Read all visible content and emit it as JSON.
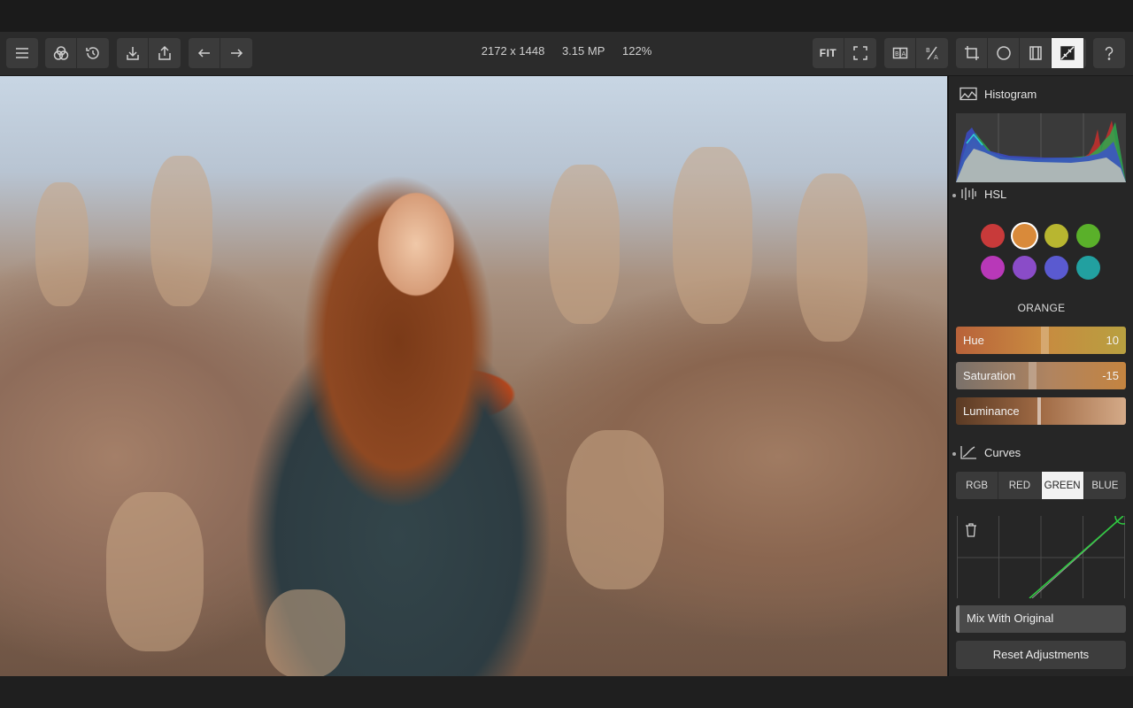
{
  "toolbar": {
    "fit_label": "FIT",
    "ba_label": "B|A",
    "info": {
      "dimensions": "2172 x 1448",
      "megapixels": "3.15 MP",
      "zoom": "122%"
    }
  },
  "panel": {
    "histogram_title": "Histogram",
    "hsl_title": "HSL",
    "hsl_colors": [
      "#c83a3a",
      "#d98a3a",
      "#b8b630",
      "#5ab02a",
      "#b838b8",
      "#8a4cc8",
      "#5a5ad0",
      "#22a0a0"
    ],
    "selected_color_name": "ORANGE",
    "sliders": {
      "hue": {
        "label": "Hue",
        "value": "10"
      },
      "saturation": {
        "label": "Saturation",
        "value": "-15"
      },
      "luminance": {
        "label": "Luminance",
        "value": ""
      }
    },
    "curves_title": "Curves",
    "curve_tabs": [
      "RGB",
      "RED",
      "GREEN",
      "BLUE"
    ],
    "active_curve_tab": "GREEN",
    "mix_label": "Mix With Original",
    "reset_label": "Reset Adjustments"
  }
}
